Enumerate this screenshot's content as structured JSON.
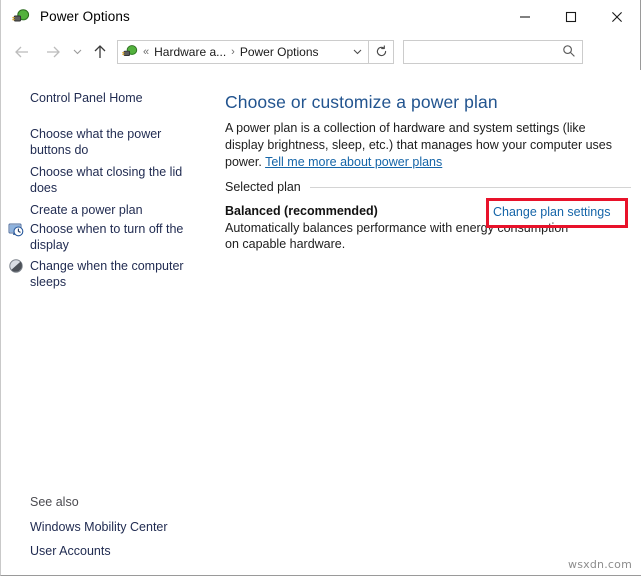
{
  "window": {
    "title": "Power Options",
    "icon": "power-plug-icon",
    "accent_color": "#1a79b5",
    "controls": {
      "minimize": "—",
      "maximize": "□",
      "close": "✕"
    }
  },
  "navbar": {
    "back": "←",
    "forward": "→",
    "recent": "∨",
    "up": "↑",
    "breadcrumb": {
      "icon": "power-plug-icon",
      "overflow": "«",
      "separator": "›",
      "items": [
        "Hardware a...",
        "Power Options"
      ],
      "dropdown": "∨"
    },
    "refresh": "↻",
    "search": {
      "value": "",
      "placeholder": "",
      "icon": "search-icon"
    }
  },
  "help": {
    "label": "?",
    "color": "#1572b8"
  },
  "sidebar": {
    "items": [
      {
        "label": "Control Panel Home",
        "icon": null
      },
      {
        "label": "Choose what the power buttons do",
        "icon": null
      },
      {
        "label": "Choose what closing the lid does",
        "icon": null
      },
      {
        "label": "Create a power plan",
        "icon": null
      },
      {
        "label": "Choose when to turn off the display",
        "icon": "display-clock-icon"
      },
      {
        "label": "Change when the computer sleeps",
        "icon": "moon-sleep-icon"
      }
    ],
    "see_also": {
      "label": "See also",
      "items": [
        {
          "label": "Windows Mobility Center"
        },
        {
          "label": "User Accounts"
        }
      ]
    }
  },
  "content": {
    "page_title": "Choose or customize a power plan",
    "intro_part1": "A power plan is a collection of hardware and system settings (like display brightness, sleep, etc.) that manages how your computer uses power. ",
    "intro_link": "Tell me more about power plans",
    "selected_plan_label": "Selected plan",
    "plan_name": "Balanced (recommended)",
    "plan_description": "Automatically balances performance with energy consumption on capable hardware.",
    "change_plan_settings": "Change plan settings"
  },
  "annotation": {
    "color": "#e8122a",
    "target": "Change plan settings"
  },
  "watermark": "wsxdn.com"
}
